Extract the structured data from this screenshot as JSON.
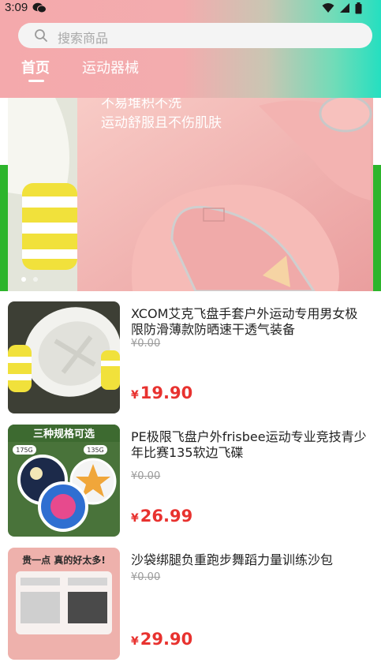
{
  "status_bar": {
    "time": "3:09",
    "left_icon": "wechat-icon",
    "right_icons": [
      "wifi-icon",
      "signal-icon",
      "battery-icon"
    ]
  },
  "search": {
    "placeholder": "搜索商品",
    "icon": "search-icon"
  },
  "tabs": [
    {
      "label": "首页",
      "active": true
    },
    {
      "label": "运动器械",
      "active": false
    }
  ],
  "banner": {
    "text_line_1": "不易堆积不洗",
    "text_line_2": "运动舒服且不伤肌肤",
    "slide_count": 2,
    "active_slide": 0
  },
  "products": [
    {
      "title": "XCOM艾克飞盘手套户外运动专用男女极限防滑薄款防晒速干透气装备",
      "original_price": "0.00",
      "price": "19.90",
      "image": "frisbee-glove-photo"
    },
    {
      "title": "PE极限飞盘户外frisbee运动专业竞技青少年比赛135软边飞碟",
      "original_price": "0.00",
      "price": "26.99",
      "image": "frisbee-set-photo",
      "image_caption": "三种规格可选",
      "image_badges": [
        "175G",
        "135G"
      ]
    },
    {
      "title": "沙袋绑腿负重跑步舞蹈力量训练沙包",
      "original_price": "0.00",
      "price": "29.90",
      "image": "sandbag-photo",
      "image_caption": "贵一点 真的好太多!"
    }
  ],
  "colors": {
    "header_pink": "#f4a9ac",
    "header_teal": "#25dfc0",
    "price_red": "#e8322f",
    "banner_side_green": "#2db52c"
  }
}
